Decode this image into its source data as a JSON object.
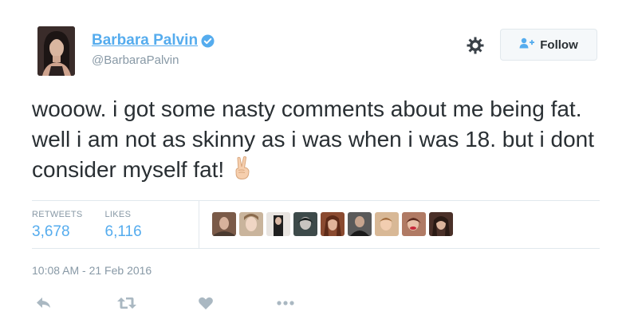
{
  "author": {
    "display_name": "Barbara Palvin",
    "handle": "@BarbaraPalvin",
    "verified": true
  },
  "follow_button": {
    "label": "Follow",
    "icon": "add-user-icon"
  },
  "settings": {
    "icon": "gear-icon"
  },
  "tweet": {
    "text": "wooow. i got some nasty comments about me being fat. well i am not as skinny as i was when i was 18. but i dont consider myself fat!",
    "emoji": "victory-hand-emoji"
  },
  "stats": {
    "retweets_label": "RETWEETS",
    "retweets_count": "3,678",
    "likes_label": "LIKES",
    "likes_count": "6,116"
  },
  "likers_count_shown": 9,
  "timestamp": "10:08 AM - 21 Feb 2016",
  "actions": [
    {
      "name": "reply-icon"
    },
    {
      "name": "retweet-icon"
    },
    {
      "name": "like-icon"
    },
    {
      "name": "more-icon"
    }
  ],
  "colors": {
    "link_blue": "#55acee",
    "text": "#292f33",
    "muted": "#8899a6",
    "border": "#e1e8ed",
    "icon_gray": "#aab8c2"
  }
}
